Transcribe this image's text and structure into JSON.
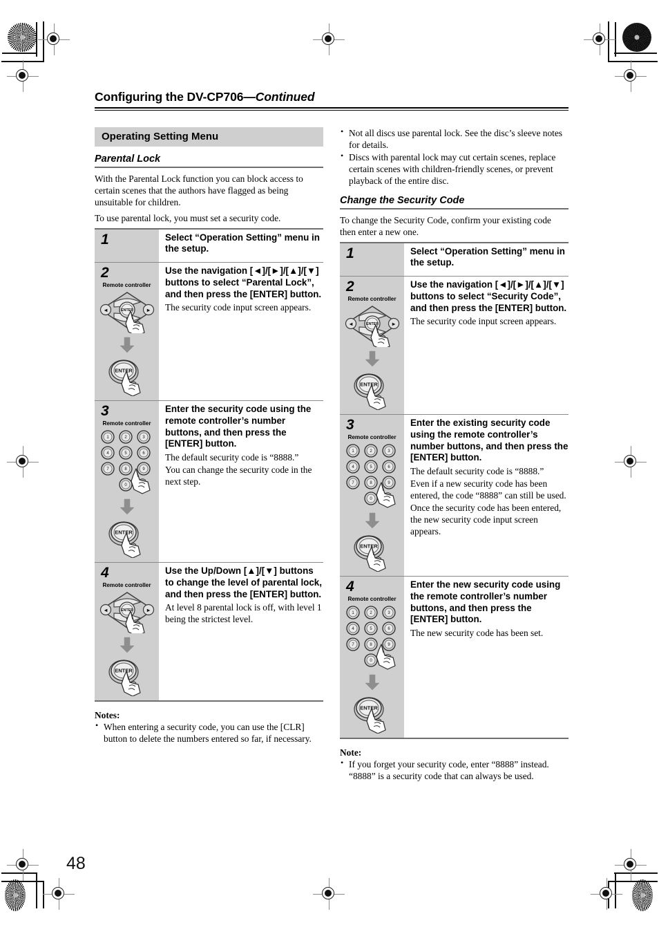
{
  "page": {
    "folio": "48",
    "running_head_main": "Configuring the DV-CP706",
    "running_head_continued": "—Continued"
  },
  "left_column": {
    "section_bar": "Operating Setting Menu",
    "subhead": "Parental Lock",
    "intro_paragraph_1": "With the Parental Lock function you can block access to certain scenes that the authors have flagged as being unsuitable for children.",
    "intro_paragraph_2": "To use parental lock, you must set a security code.",
    "steps": [
      {
        "number": "1",
        "remote_label": "",
        "title": "Select “Operation Setting” menu in the setup.",
        "descriptions": [],
        "graphic": "none"
      },
      {
        "number": "2",
        "remote_label": "Remote controller",
        "title": "Use the navigation [◄]/[►]/[▲]/[▼] buttons to select “Parental Lock”, and then press the [ENTER] button.",
        "descriptions": [
          "The security code input screen appears."
        ],
        "graphic": "nav-pad-then-enter"
      },
      {
        "number": "3",
        "remote_label": "Remote controller",
        "title": "Enter the security code using the remote controller’s number buttons, and then press the [ENTER] button.",
        "descriptions": [
          "The default security code is “8888.”",
          "You can change the security code in the next step."
        ],
        "graphic": "number-pad-then-enter"
      },
      {
        "number": "4",
        "remote_label": "Remote controller",
        "title": "Use the Up/Down [▲]/[▼] buttons to change the level of parental lock, and then press the [ENTER] button.",
        "descriptions": [
          "At level 8 parental lock is off, with level 1 being the strictest level."
        ],
        "graphic": "nav-pad-then-enter"
      }
    ],
    "notes_heading": "Notes:",
    "notes": [
      "When entering a security code, you can use the [CLR] button to delete the numbers entered so far, if necessary."
    ]
  },
  "right_column": {
    "top_bullets": [
      "Not all discs use parental lock. See the disc’s sleeve notes for details.",
      "Discs with parental lock may cut certain scenes, replace certain scenes with children-friendly scenes, or prevent playback of the entire disc."
    ],
    "subhead": "Change the Security Code",
    "intro_paragraph_1": "To change the Security Code, confirm your existing code then enter a new one.",
    "steps": [
      {
        "number": "1",
        "remote_label": "",
        "title": "Select “Operation Setting” menu in the setup.",
        "descriptions": [],
        "graphic": "none"
      },
      {
        "number": "2",
        "remote_label": "Remote controller",
        "title": "Use the navigation [◄]/[►]/[▲]/[▼] buttons to select “Security Code”, and then press the [ENTER] button.",
        "descriptions": [
          "The security code input screen appears."
        ],
        "graphic": "nav-pad-then-enter"
      },
      {
        "number": "3",
        "remote_label": "Remote controller",
        "title": "Enter the existing security code using the remote controller’s number buttons, and then press the [ENTER] button.",
        "descriptions": [
          "The default security code is “8888.”",
          "Even if a new security code has been entered, the code “8888” can still be used.",
          "Once the security code has been entered, the new security code input screen appears."
        ],
        "graphic": "number-pad-then-enter"
      },
      {
        "number": "4",
        "remote_label": "Remote controller",
        "title": "Enter the new security code using the remote controller’s number buttons, and then press the [ENTER] button.",
        "descriptions": [
          "The new security code has been set."
        ],
        "graphic": "number-pad-then-enter"
      }
    ],
    "notes_heading": "Note:",
    "notes": [
      "If you forget your security code, enter “8888” instead. “8888” is a security code that can always be used."
    ]
  },
  "remote_graphics": {
    "enter_label": "ENTER",
    "number_keys": [
      "1",
      "2",
      "3",
      "4",
      "5",
      "6",
      "7",
      "8",
      "9",
      "0"
    ],
    "nav_up": "▲",
    "nav_down": "▼",
    "nav_left": "◄",
    "nav_right": "►"
  },
  "colors": {
    "section_bar_gray": "#cfcfcf",
    "rule_gray": "#6f6f6f",
    "text_black": "#000000",
    "graphic_gray": "#9a9a9a"
  }
}
